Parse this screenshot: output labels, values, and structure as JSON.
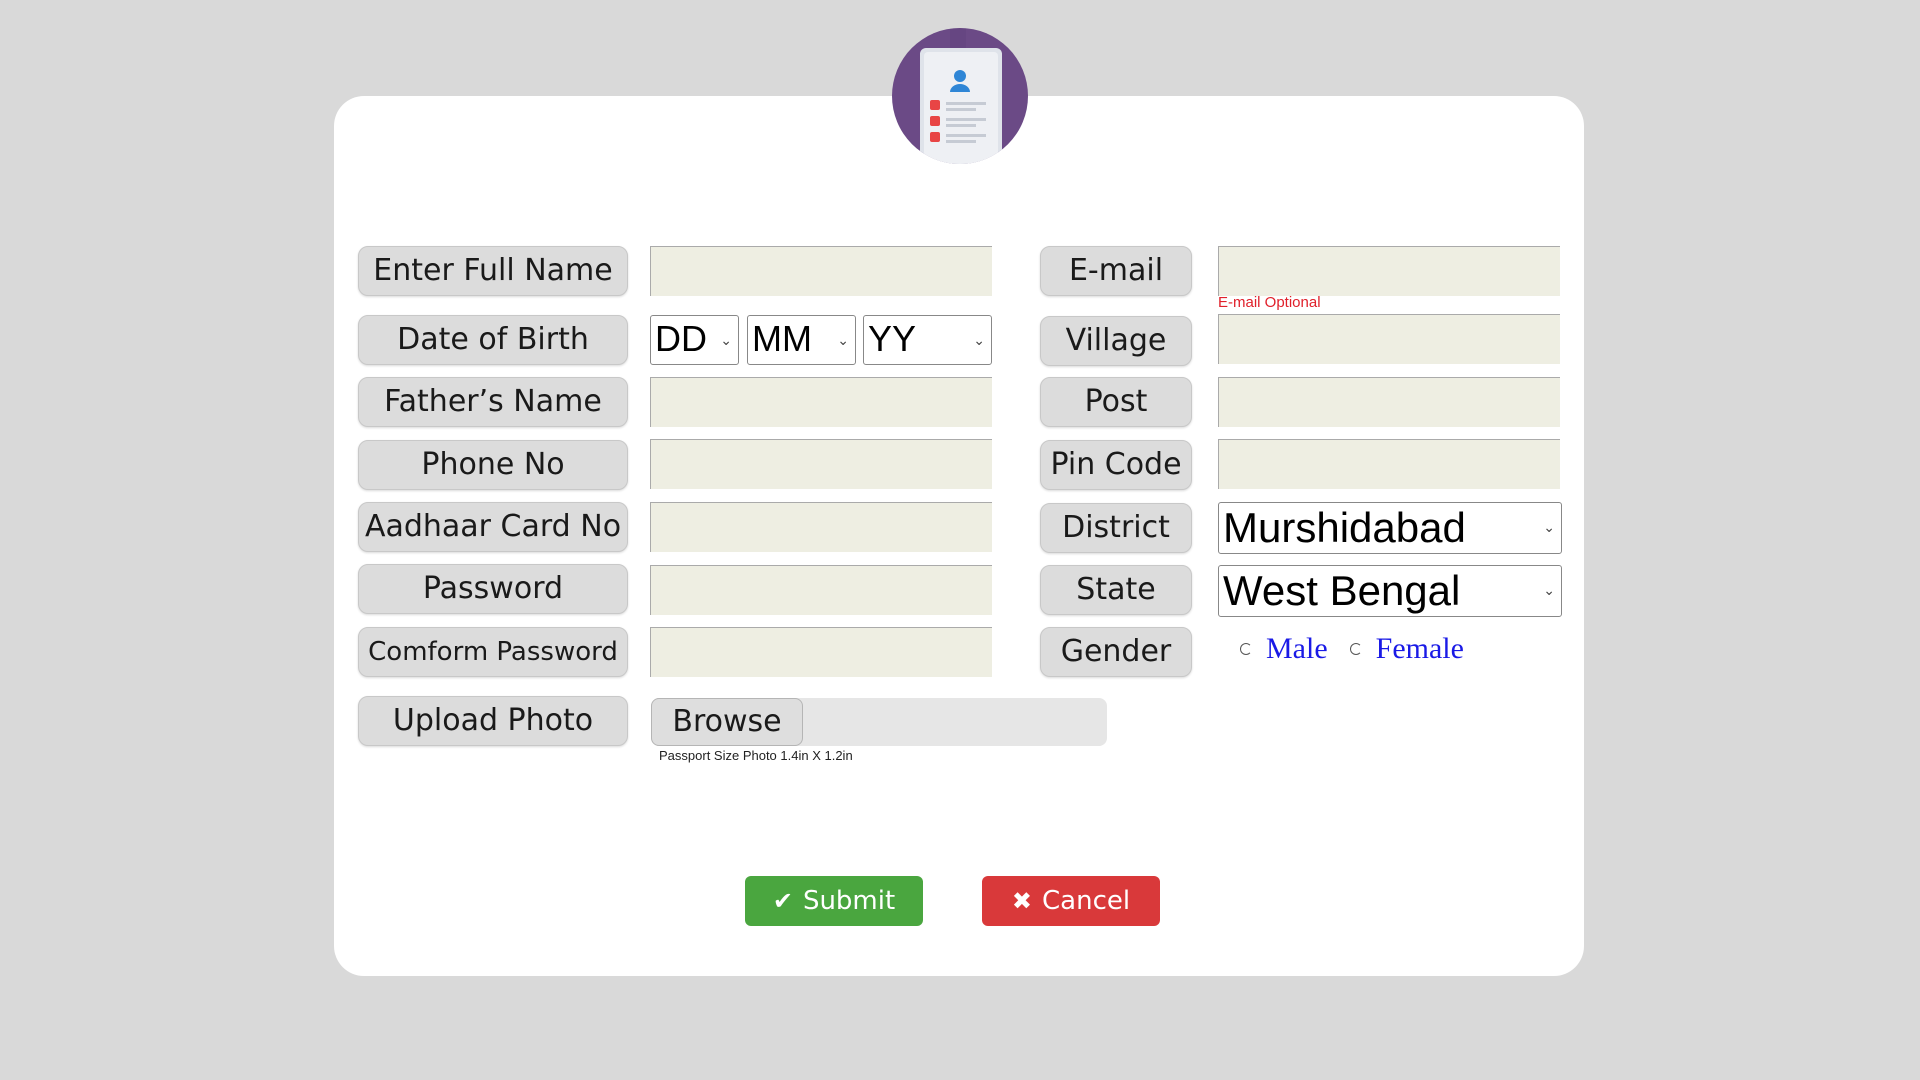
{
  "form": {
    "labels": {
      "full_name": "Enter Full Name",
      "dob": "Date of Birth",
      "father_name": "Father’s Name",
      "phone": "Phone No",
      "aadhaar": "Aadhaar Card No",
      "password": "Password",
      "confirm_password": "Comform Password",
      "upload_photo": "Upload Photo",
      "email": "E-mail",
      "village": "Village",
      "post": "Post",
      "pin_code": "Pin Code",
      "district": "District",
      "state": "State",
      "gender": "Gender"
    },
    "dob_selects": {
      "day": "DD",
      "month": "MM",
      "year": "YY"
    },
    "email_hint": "E-mail Optional",
    "district_value": "Murshidabad",
    "state_value": "West Bengal",
    "gender_options": {
      "male": "Male",
      "female": "Female"
    },
    "browse_label": "Browse",
    "photo_hint": "Passport Size Photo 1.4in X 1.2in"
  },
  "actions": {
    "submit_label": "Submit",
    "cancel_label": "Cancel",
    "submit_icon": "check-icon",
    "cancel_icon": "x-icon"
  },
  "colors": {
    "submit": "#4aa63f",
    "cancel": "#d9393a",
    "hint": "#e0202a",
    "avatar_bg": "#6b4a86",
    "radio_text": "#1a1ae6"
  }
}
